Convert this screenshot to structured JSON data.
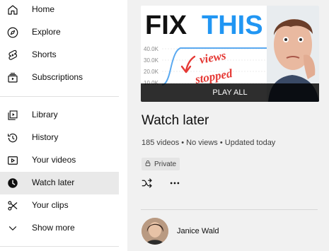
{
  "sidebar": {
    "items": [
      {
        "label": "Home",
        "icon": "home-icon"
      },
      {
        "label": "Explore",
        "icon": "compass-icon"
      },
      {
        "label": "Shorts",
        "icon": "shorts-icon"
      },
      {
        "label": "Subscriptions",
        "icon": "subscriptions-icon"
      },
      {
        "label": "Library",
        "icon": "library-icon"
      },
      {
        "label": "History",
        "icon": "history-icon"
      },
      {
        "label": "Your videos",
        "icon": "your-videos-icon"
      },
      {
        "label": "Watch later",
        "icon": "clock-icon",
        "active": true
      },
      {
        "label": "Your clips",
        "icon": "scissors-icon"
      },
      {
        "label": "Show more",
        "icon": "chevron-down-icon"
      }
    ]
  },
  "playlist": {
    "thumbnail": {
      "headline_word1": "FIX",
      "headline_word2": "THIS",
      "scribble_line1": "views",
      "scribble_line2": "stopped",
      "axis_labels": [
        "40.0K",
        "30.0K",
        "20.0K",
        "10.0K"
      ],
      "play_all_label": "PLAY ALL"
    },
    "title": "Watch later",
    "meta": "185 videos • No views • Updated today",
    "privacy_label": "Private",
    "owner_name": "Janice Wald"
  },
  "colors": {
    "active_bg": "#e9e9e9",
    "panel_bg": "#f1f1f1",
    "headline_blue": "#2196f3",
    "scribble_red": "#e53935"
  }
}
